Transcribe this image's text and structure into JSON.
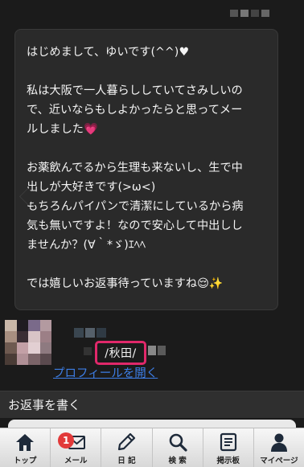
{
  "message": {
    "paragraphs": [
      [
        "はじめまして、ゆいです(^^)♥"
      ],
      [
        "私は大阪で一人暮らししていてさみしいの",
        "で、近いならもしよかったらと思ってメー",
        "ルしました💗"
      ],
      [
        "お薬飲んでるから生理も来ないし、生で中",
        "出しが大好きです(>ω<)",
        "もちろんパイパンで清潔にしているから病",
        "気も無いですよ！なので安心して中出しし",
        "ませんか？(∀｀*ゞ)ｴﾍﾍ"
      ],
      [
        "では嬉しいお返事待っていますね😌✨"
      ]
    ]
  },
  "sender": {
    "location": "/秋田/",
    "profile_link": "プロフィールを開く"
  },
  "reply": {
    "label": "お返事を書く"
  },
  "tabbar": {
    "items": [
      {
        "label": "トップ",
        "icon": "home-icon"
      },
      {
        "label": "メール",
        "icon": "mail-icon",
        "badge": "1"
      },
      {
        "label": "日 記",
        "icon": "pencil-icon"
      },
      {
        "label": "検 索",
        "icon": "search-icon"
      },
      {
        "label": "掲示板",
        "icon": "board-icon"
      },
      {
        "label": "マイページ",
        "icon": "person-icon"
      }
    ]
  },
  "colors": {
    "background": "#1b1b1b",
    "bubble": "#2a2a2a",
    "highlight": "#e0286a",
    "link": "#3d7ee6",
    "badge": "#e23a3a"
  }
}
